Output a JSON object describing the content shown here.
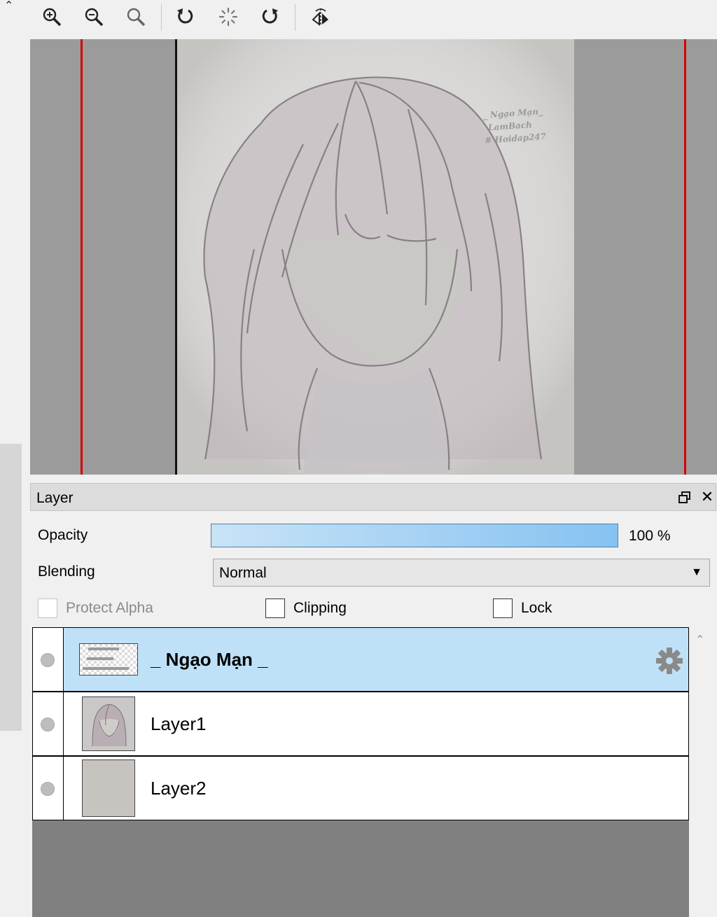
{
  "toolbar": {
    "collapse_icon": "chevron-up-icon",
    "buttons": [
      {
        "name": "zoom-in-icon"
      },
      {
        "name": "zoom-out-icon"
      },
      {
        "name": "zoom-reset-icon"
      },
      {
        "name": "rotate-left-icon"
      },
      {
        "name": "rotate-reset-icon"
      },
      {
        "name": "rotate-right-icon"
      },
      {
        "name": "flip-horizontal-icon"
      }
    ]
  },
  "canvas": {
    "watermark_lines": [
      "_ Ngạo Mạn_",
      "LamBach",
      "# Hoidap247"
    ],
    "colors": {
      "guide": "#d30000",
      "background": "#9b9b9b",
      "paper": "#d9d8d6"
    }
  },
  "panel": {
    "title": "Layer",
    "opacity": {
      "label": "Opacity",
      "value_text": "100 %",
      "value": 100
    },
    "blending": {
      "label": "Blending",
      "value": "Normal"
    },
    "checkboxes": {
      "protect_alpha": {
        "label": "Protect Alpha",
        "checked": false,
        "enabled": false
      },
      "clipping": {
        "label": "Clipping",
        "checked": false
      },
      "lock": {
        "label": "Lock",
        "checked": false
      }
    },
    "layers": [
      {
        "name": "_ Ngạo Mạn _",
        "selected": true,
        "thumb": "text-watermark",
        "settings_icon": "gear-icon"
      },
      {
        "name": "Layer1",
        "selected": false,
        "thumb": "sketch"
      },
      {
        "name": "Layer2",
        "selected": false,
        "thumb": "fill"
      }
    ],
    "colors": {
      "selected_row": "#bfe1f8",
      "opacity_fill": "#86c2f1"
    }
  }
}
